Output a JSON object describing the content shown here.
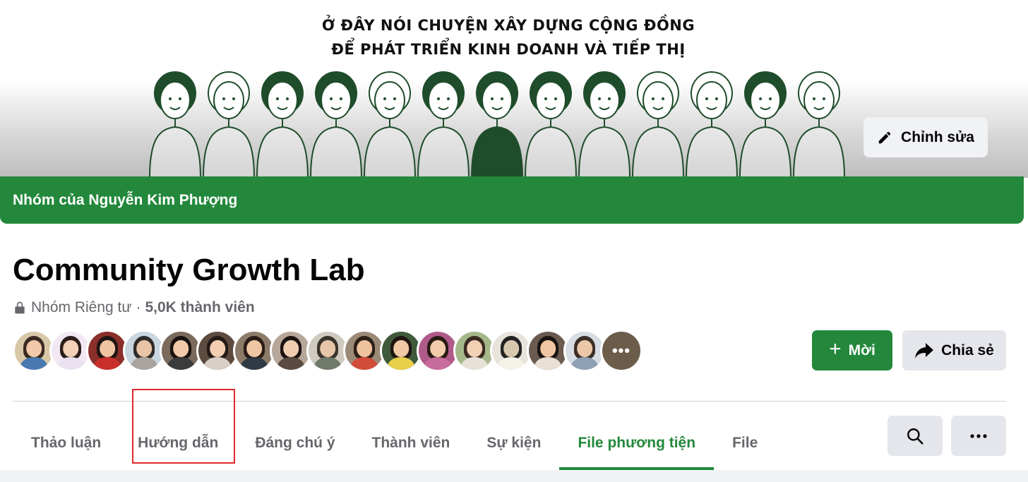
{
  "cover": {
    "line1": "Ở ĐÂY NÓI CHUYỆN XÂY DỰNG CỘNG ĐỒNG",
    "line2": "ĐỂ PHÁT TRIỂN KINH DOANH VÀ TIẾP THỊ",
    "edit_label": "Chỉnh sửa"
  },
  "group_bar": {
    "label": "Nhóm của Nguyễn Kim Phượng"
  },
  "group": {
    "name": "Community Growth Lab",
    "privacy": "Nhóm Riêng tư",
    "separator": "·",
    "members": "5,0K thành viên"
  },
  "avatars": {
    "count": 17,
    "more_symbol": "•••"
  },
  "actions": {
    "invite_label": "Mời",
    "invite_icon": "+",
    "share_label": "Chia sẻ"
  },
  "tabs": [
    {
      "label": "Thảo luận",
      "active": false
    },
    {
      "label": "Hướng dẫn",
      "active": false,
      "highlighted": true
    },
    {
      "label": "Đáng chú ý",
      "active": false
    },
    {
      "label": "Thành viên",
      "active": false
    },
    {
      "label": "Sự kiện",
      "active": false
    },
    {
      "label": "File phương tiện",
      "active": true
    },
    {
      "label": "File",
      "active": false
    }
  ],
  "icons": {
    "edit": "pencil-icon",
    "lock": "lock-icon",
    "share": "share-arrow-icon",
    "search": "search-icon",
    "more": "more-horizontal-icon"
  },
  "colors": {
    "brand_green": "#23883b",
    "highlight_red": "#e0282c",
    "button_gray": "#e4e6eb",
    "text_secondary": "#65676b"
  }
}
